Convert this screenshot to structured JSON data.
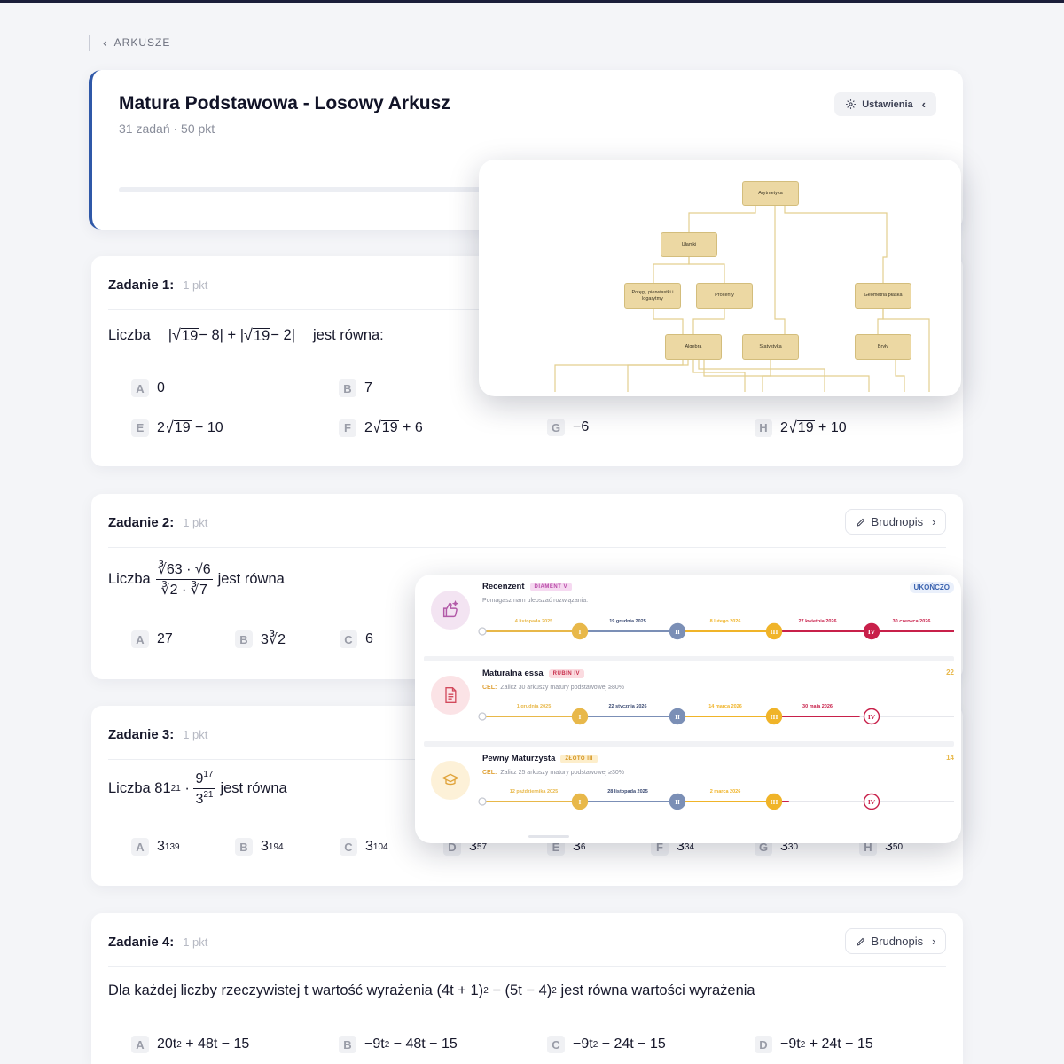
{
  "breadcrumb": {
    "label": "ARKUSZE"
  },
  "header": {
    "title": "Matura Podstawowa - Losowy Arkusz",
    "subtitle": "31 zadań · 50 pkt",
    "settings_label": "Ustawienia"
  },
  "draft_label": "Brudnopis",
  "tasks": [
    {
      "title": "Zadanie 1:",
      "points": "1 pkt",
      "question": {
        "prefix": "Liczba",
        "abs1": "|",
        "rad1": "19",
        "minus8": " − 8|",
        "plus": " + ",
        "abs2": "|",
        "rad2": "19",
        "minus2": " − 2|",
        "suffix": "jest równa:"
      },
      "answers": [
        {
          "letter": "A",
          "text": "0"
        },
        {
          "letter": "B",
          "text": "7"
        },
        {
          "letter": "E",
          "pre": "2",
          "rad": "19",
          "post": " − 10"
        },
        {
          "letter": "F",
          "pre": "2",
          "rad": "19",
          "post": " + 6"
        },
        {
          "letter": "G",
          "text": "−6"
        },
        {
          "letter": "H",
          "pre": "2",
          "rad": "19",
          "post": " + 10"
        }
      ]
    },
    {
      "title": "Zadanie 2:",
      "points": "1 pkt",
      "question": {
        "prefix": "Liczba",
        "num": "∛63 · √6",
        "den": "∛2 · ∛7",
        "suffix": "jest równa"
      },
      "answers": [
        {
          "letter": "A",
          "text": "27"
        },
        {
          "letter": "B",
          "text": "3∛2"
        },
        {
          "letter": "C",
          "text": "6"
        }
      ]
    },
    {
      "title": "Zadanie 3:",
      "points": "1 pkt",
      "question": {
        "prefix": "Liczba 81",
        "exp": "21",
        "dot": " · ",
        "num_base": "9",
        "num_exp": "17",
        "den_base": "3",
        "den_exp": "21",
        "suffix": "jest równa"
      },
      "answers": [
        {
          "letter": "A",
          "base": "3",
          "exp": "139"
        },
        {
          "letter": "B",
          "base": "3",
          "exp": "194"
        },
        {
          "letter": "C",
          "base": "3",
          "exp": "104"
        },
        {
          "letter": "D",
          "base": "3",
          "exp": "57"
        },
        {
          "letter": "E",
          "base": "3",
          "exp": "6"
        },
        {
          "letter": "F",
          "base": "3",
          "exp": "34"
        },
        {
          "letter": "G",
          "base": "3",
          "exp": "30"
        },
        {
          "letter": "H",
          "base": "3",
          "exp": "50"
        }
      ]
    },
    {
      "title": "Zadanie 4:",
      "points": "1 pkt",
      "question": {
        "p1": "Dla każdej liczby rzeczywistej t wartość wyrażenia (4t + 1)",
        "e1": "2",
        "p2": " − (5t − 4)",
        "e2": "2",
        "p3": " jest równa wartości wyrażenia"
      },
      "answers": [
        {
          "letter": "A",
          "a": "20t",
          "e": "2",
          "b": " + 48t − 15"
        },
        {
          "letter": "B",
          "a": "−9t",
          "e": "2",
          "b": " − 48t − 15"
        },
        {
          "letter": "C",
          "a": "−9t",
          "e": "2",
          "b": " − 24t − 15"
        },
        {
          "letter": "D",
          "a": "−9t",
          "e": "2",
          "b": " + 24t − 15"
        }
      ]
    }
  ],
  "diagram": {
    "nodes": [
      "Arytmetyka",
      "Ułamki",
      "Potęgi, pierwiastki i logarytmy",
      "Procenty",
      "Geometria płaska",
      "Algebra",
      "Statystyka",
      "Bryły"
    ],
    "colors": {
      "node": "#ecd8a3",
      "line": "#e3cf8f"
    }
  },
  "achievements": [
    {
      "name": "Recenzent",
      "badge": "DIAMENT V",
      "desc": "Pomagasz nam ulepszać rozwiązania.",
      "goal_label": "",
      "corner": "UKOŃCZO",
      "icon": "thumbs-up-star-icon",
      "dates": [
        "4 listopada 2025",
        "19 grudnia 2025",
        "8 lutego 2026",
        "27 kwietnia 2026",
        "30 czerwca 2026"
      ],
      "levels": [
        "I",
        "II",
        "III",
        "IV"
      ],
      "progress": 1.0
    },
    {
      "name": "Maturalna essa",
      "badge": "RUBIN IV",
      "goal_label": "CEL:",
      "desc": "Zalicz 30 arkuszy matury podstawowej ≥80%",
      "corner": "22",
      "icon": "document-icon",
      "dates": [
        "1 grudnia 2025",
        "22 stycznia 2026",
        "14 marca 2026",
        "30 maja 2026"
      ],
      "levels": [
        "I",
        "II",
        "III",
        "IV"
      ],
      "progress": 0.8
    },
    {
      "name": "Pewny Maturzysta",
      "badge": "ZŁOTO III",
      "goal_label": "CEL:",
      "desc": "Zalicz 25 arkuszy matury podstawowej ≥30%",
      "corner": "14",
      "icon": "graduation-cap-icon",
      "dates": [
        "12 października 2025",
        "28 listopada 2025",
        "2 marca 2026"
      ],
      "levels": [
        "I",
        "II",
        "III",
        "IV"
      ],
      "progress": 0.65
    }
  ],
  "colors": {
    "accent": "#2f58a8",
    "level1": "#e8b84a",
    "level2": "#7b8fb6",
    "level3": "#f0b429",
    "level4": "#c8204a",
    "ach1_bg": "#f3e4f2",
    "ach2_bg": "#fbe3e6",
    "ach3_bg": "#fdf1d8"
  }
}
